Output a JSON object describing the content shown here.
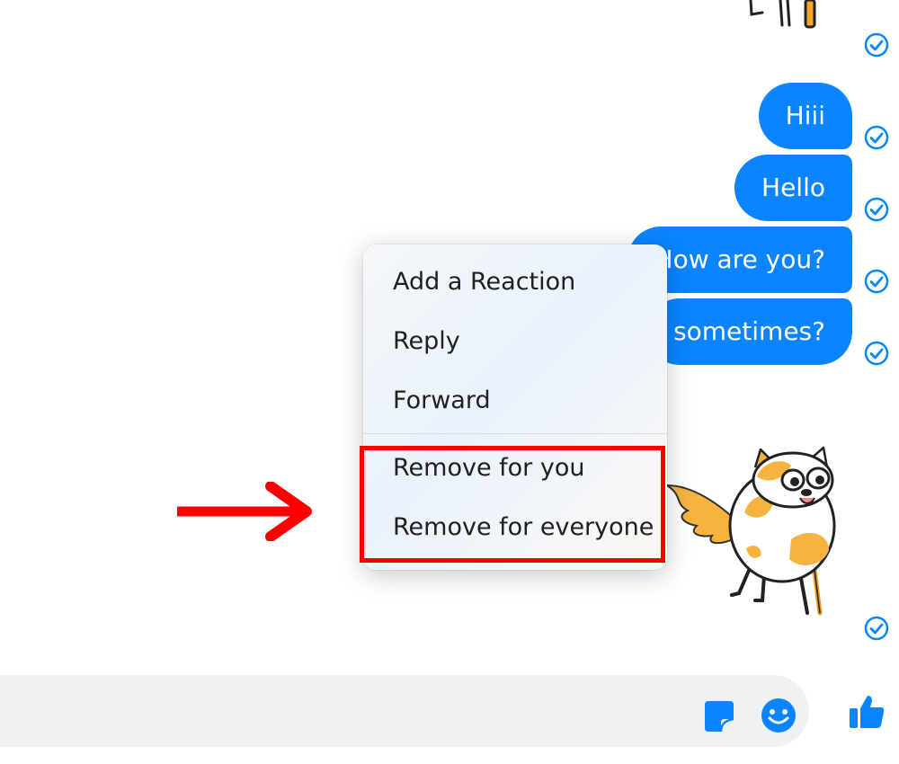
{
  "messages": [
    {
      "text": "Hiii"
    },
    {
      "text": "Hello"
    },
    {
      "text": "How are you?"
    },
    {
      "text": "sometimes?"
    }
  ],
  "context_menu": {
    "items": [
      {
        "label": "Add a Reaction"
      },
      {
        "label": "Reply"
      },
      {
        "label": "Forward"
      },
      {
        "label": "Remove for you"
      },
      {
        "label": "Remove for everyone"
      }
    ]
  },
  "composer": {
    "sticker_icon": "sticker-icon",
    "emoji_icon": "emoji-icon",
    "like_icon": "thumbs-up-icon"
  },
  "colors": {
    "accent": "#0a84ff",
    "annotation": "#ff0000",
    "composer_bg": "#f0f1f3"
  }
}
